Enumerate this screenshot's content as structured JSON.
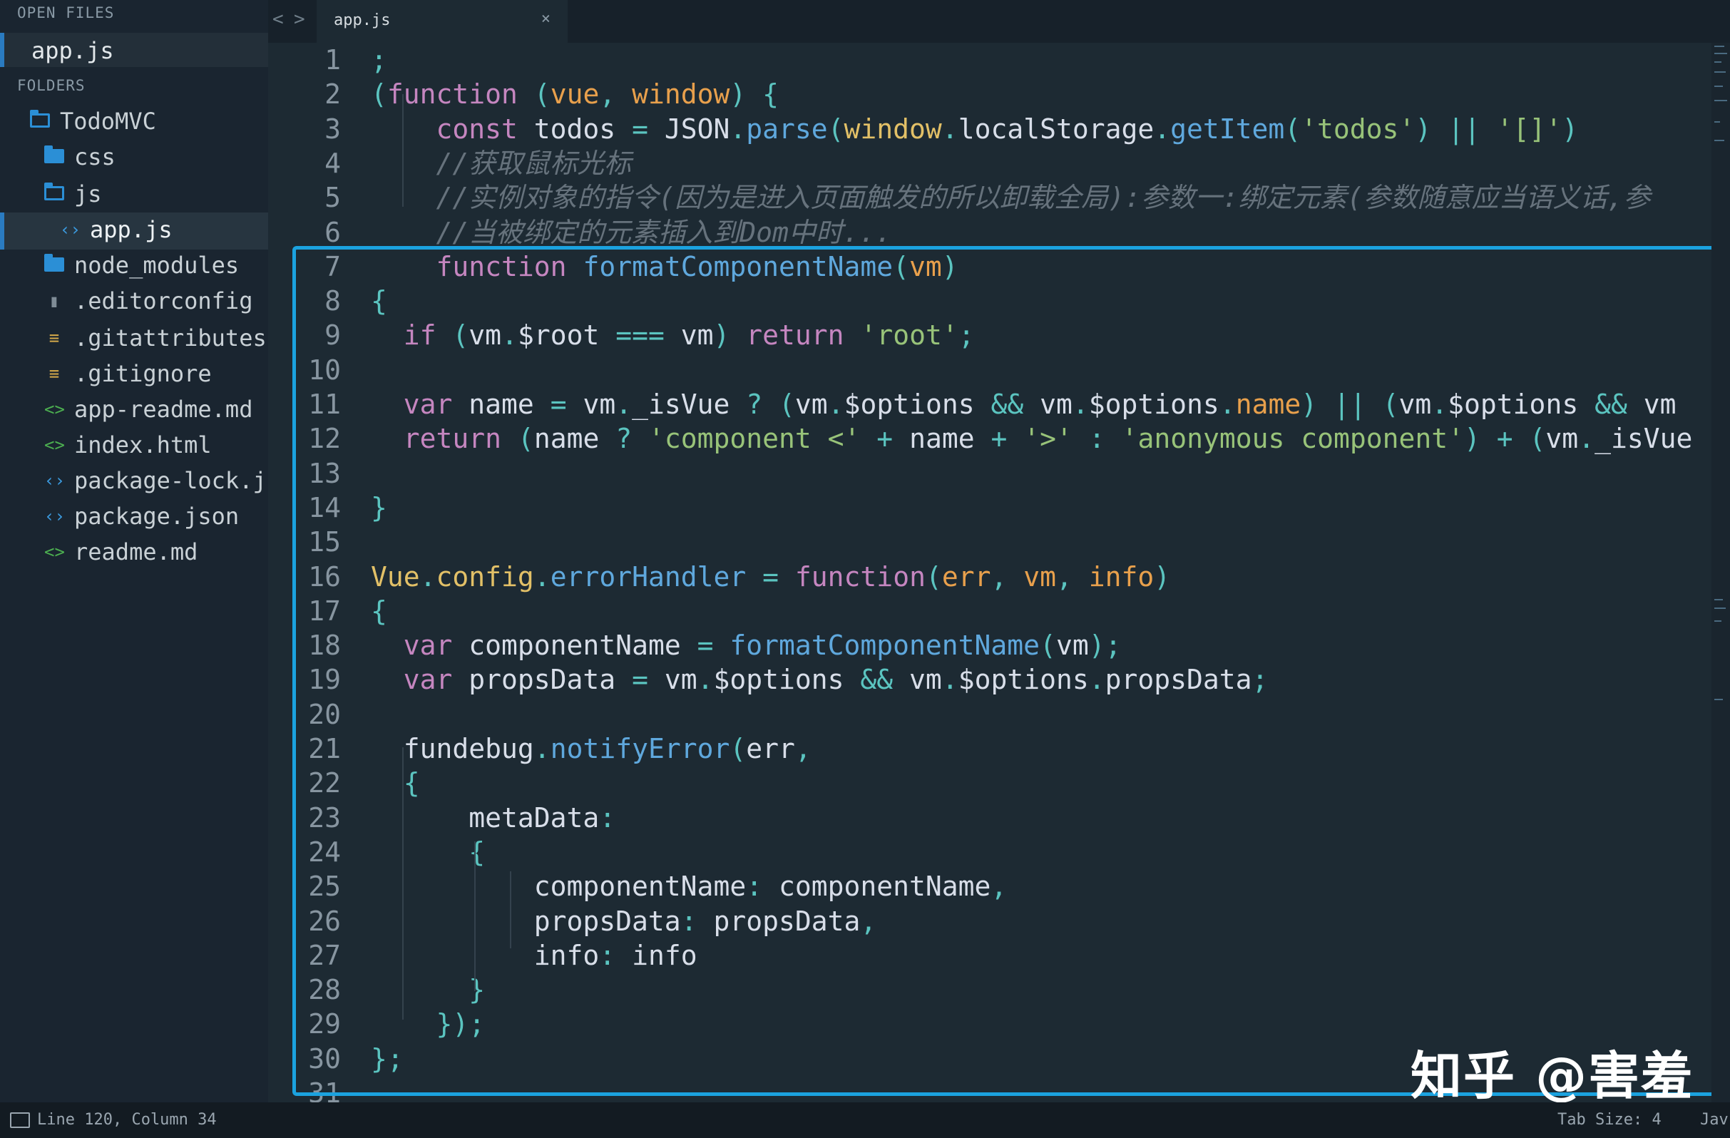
{
  "sidebar": {
    "open_files_header": "OPEN FILES",
    "open_file": "app.js",
    "folders_header": "FOLDERS",
    "tree": [
      {
        "label": "TodoMVC",
        "type": "folder-open"
      },
      {
        "label": "css",
        "type": "folder"
      },
      {
        "label": "js",
        "type": "folder-open"
      },
      {
        "label": "app.js",
        "type": "code-file"
      },
      {
        "label": "node_modules",
        "type": "folder"
      },
      {
        "label": ".editorconfig",
        "type": "file"
      },
      {
        "label": ".gitattributes",
        "type": "text-file"
      },
      {
        "label": ".gitignore",
        "type": "text-file"
      },
      {
        "label": "app-readme.md",
        "type": "markup-file"
      },
      {
        "label": "index.html",
        "type": "markup-file"
      },
      {
        "label": "package-lock.j",
        "type": "code-file"
      },
      {
        "label": "package.json",
        "type": "code-file"
      },
      {
        "label": "readme.md",
        "type": "markup-file"
      }
    ]
  },
  "tabs": {
    "nav_back": "<",
    "nav_forward": ">",
    "active_tab": "app.js",
    "close_glyph": "×"
  },
  "editor": {
    "line_numbers": [
      "1",
      "2",
      "3",
      "4",
      "5",
      "6",
      "7",
      "8",
      "9",
      "10",
      "11",
      "12",
      "13",
      "14",
      "15",
      "16",
      "17",
      "18",
      "19",
      "20",
      "21",
      "22",
      "23",
      "24",
      "25",
      "26",
      "27",
      "28",
      "29",
      "30",
      "31"
    ],
    "lines": [
      [
        [
          ";",
          "o"
        ]
      ],
      [
        [
          "(",
          "o"
        ],
        [
          "function",
          "k"
        ],
        [
          " (",
          "o"
        ],
        [
          "vue",
          "p"
        ],
        [
          ", ",
          "o"
        ],
        [
          "window",
          "p"
        ],
        [
          ") {",
          "o"
        ]
      ],
      [
        [
          "    ",
          ""
        ],
        [
          "const",
          "k"
        ],
        [
          " todos ",
          "t"
        ],
        [
          "=",
          "o"
        ],
        [
          " JSON",
          "t"
        ],
        [
          ".",
          "o"
        ],
        [
          "parse",
          "f"
        ],
        [
          "(",
          "o"
        ],
        [
          "window",
          "y"
        ],
        [
          ".",
          "o"
        ],
        [
          "localStorage",
          "t"
        ],
        [
          ".",
          "o"
        ],
        [
          "getItem",
          "f"
        ],
        [
          "(",
          "o"
        ],
        [
          "'todos'",
          "s"
        ],
        [
          ") ",
          "o"
        ],
        [
          "||",
          "o"
        ],
        [
          " ",
          "t"
        ],
        [
          "'[]'",
          "s"
        ],
        [
          ")",
          "o"
        ]
      ],
      [
        [
          "    //获取鼠标光标",
          "c"
        ]
      ],
      [
        [
          "    //实例对象的指令(因为是进入页面触发的所以卸载全局):参数一:绑定元素(参数随意应当语义话,参",
          "c"
        ]
      ],
      [
        [
          "    //当被绑定的元素插入到Dom中时...",
          "c"
        ]
      ],
      [
        [
          "    ",
          ""
        ],
        [
          "function",
          "k"
        ],
        [
          " ",
          "t"
        ],
        [
          "formatComponentName",
          "f"
        ],
        [
          "(",
          "o"
        ],
        [
          "vm",
          "p"
        ],
        [
          ")",
          "o"
        ]
      ],
      [
        [
          "{",
          "o"
        ]
      ],
      [
        [
          "  ",
          ""
        ],
        [
          "if",
          "k"
        ],
        [
          " (",
          "o"
        ],
        [
          "vm",
          "t"
        ],
        [
          ".",
          "o"
        ],
        [
          "$root",
          "t"
        ],
        [
          " ",
          "t"
        ],
        [
          "===",
          "o"
        ],
        [
          " vm",
          "t"
        ],
        [
          ") ",
          "o"
        ],
        [
          "return",
          "k"
        ],
        [
          " ",
          "t"
        ],
        [
          "'root'",
          "s"
        ],
        [
          ";",
          "o"
        ]
      ],
      [
        [
          "",
          ""
        ]
      ],
      [
        [
          "  ",
          ""
        ],
        [
          "var",
          "k"
        ],
        [
          " name ",
          "t"
        ],
        [
          "=",
          "o"
        ],
        [
          " vm",
          "t"
        ],
        [
          ".",
          "o"
        ],
        [
          "_isVue ",
          "t"
        ],
        [
          "?",
          "o"
        ],
        [
          " (",
          "o"
        ],
        [
          "vm",
          "t"
        ],
        [
          ".",
          "o"
        ],
        [
          "$options ",
          "t"
        ],
        [
          "&&",
          "o"
        ],
        [
          " vm",
          "t"
        ],
        [
          ".",
          "o"
        ],
        [
          "$options",
          "t"
        ],
        [
          ".",
          "o"
        ],
        [
          "name",
          "p"
        ],
        [
          ") ",
          "o"
        ],
        [
          "||",
          "o"
        ],
        [
          " (",
          "o"
        ],
        [
          "vm",
          "t"
        ],
        [
          ".",
          "o"
        ],
        [
          "$options ",
          "t"
        ],
        [
          "&&",
          "o"
        ],
        [
          " vm",
          "t"
        ]
      ],
      [
        [
          "  ",
          ""
        ],
        [
          "return",
          "k"
        ],
        [
          " (",
          "o"
        ],
        [
          "name ",
          "t"
        ],
        [
          "?",
          "o"
        ],
        [
          " ",
          "t"
        ],
        [
          "'component <'",
          "s"
        ],
        [
          " ",
          "t"
        ],
        [
          "+",
          "o"
        ],
        [
          " name ",
          "t"
        ],
        [
          "+",
          "o"
        ],
        [
          " ",
          "t"
        ],
        [
          "'>'",
          "s"
        ],
        [
          " ",
          "t"
        ],
        [
          ":",
          "o"
        ],
        [
          " ",
          "t"
        ],
        [
          "'anonymous component'",
          "s"
        ],
        [
          ") ",
          "o"
        ],
        [
          "+",
          "o"
        ],
        [
          " (",
          "o"
        ],
        [
          "vm",
          "t"
        ],
        [
          ".",
          "o"
        ],
        [
          "_isVue",
          "t"
        ]
      ],
      [
        [
          "",
          ""
        ]
      ],
      [
        [
          "}",
          "o"
        ]
      ],
      [
        [
          "",
          ""
        ]
      ],
      [
        [
          "Vue",
          "y"
        ],
        [
          ".",
          "o"
        ],
        [
          "config",
          "y"
        ],
        [
          ".",
          "o"
        ],
        [
          "errorHandler",
          "f"
        ],
        [
          " ",
          "t"
        ],
        [
          "=",
          "o"
        ],
        [
          " ",
          "t"
        ],
        [
          "function",
          "k"
        ],
        [
          "(",
          "o"
        ],
        [
          "err",
          "p"
        ],
        [
          ", ",
          "o"
        ],
        [
          "vm",
          "p"
        ],
        [
          ", ",
          "o"
        ],
        [
          "info",
          "p"
        ],
        [
          ")",
          "o"
        ]
      ],
      [
        [
          "{",
          "o"
        ]
      ],
      [
        [
          "  ",
          ""
        ],
        [
          "var",
          "k"
        ],
        [
          " componentName ",
          "t"
        ],
        [
          "=",
          "o"
        ],
        [
          " ",
          "t"
        ],
        [
          "formatComponentName",
          "f"
        ],
        [
          "(",
          "o"
        ],
        [
          "vm",
          "t"
        ],
        [
          ");",
          "o"
        ]
      ],
      [
        [
          "  ",
          ""
        ],
        [
          "var",
          "k"
        ],
        [
          " propsData ",
          "t"
        ],
        [
          "=",
          "o"
        ],
        [
          " vm",
          "t"
        ],
        [
          ".",
          "o"
        ],
        [
          "$options ",
          "t"
        ],
        [
          "&&",
          "o"
        ],
        [
          " vm",
          "t"
        ],
        [
          ".",
          "o"
        ],
        [
          "$options",
          "t"
        ],
        [
          ".",
          "o"
        ],
        [
          "propsData",
          "t"
        ],
        [
          ";",
          "o"
        ]
      ],
      [
        [
          "",
          ""
        ]
      ],
      [
        [
          "  ",
          ""
        ],
        [
          "fundebug",
          "t"
        ],
        [
          ".",
          "o"
        ],
        [
          "notifyError",
          "f"
        ],
        [
          "(",
          "o"
        ],
        [
          "err",
          "t"
        ],
        [
          ",",
          "o"
        ]
      ],
      [
        [
          "  ",
          ""
        ],
        [
          "{",
          "o"
        ]
      ],
      [
        [
          "      ",
          ""
        ],
        [
          "metaData",
          "t"
        ],
        [
          ":",
          "o"
        ]
      ],
      [
        [
          "      ",
          ""
        ],
        [
          "{",
          "o"
        ]
      ],
      [
        [
          "          ",
          ""
        ],
        [
          "componentName",
          "t"
        ],
        [
          ":",
          "o"
        ],
        [
          " componentName",
          "t"
        ],
        [
          ",",
          "o"
        ]
      ],
      [
        [
          "          ",
          ""
        ],
        [
          "propsData",
          "t"
        ],
        [
          ":",
          "o"
        ],
        [
          " propsData",
          "t"
        ],
        [
          ",",
          "o"
        ]
      ],
      [
        [
          "          ",
          ""
        ],
        [
          "info",
          "t"
        ],
        [
          ":",
          "o"
        ],
        [
          " info",
          "t"
        ]
      ],
      [
        [
          "      ",
          ""
        ],
        [
          "}",
          "o"
        ]
      ],
      [
        [
          "    ",
          ""
        ],
        [
          "});",
          "o"
        ]
      ],
      [
        [
          "};",
          "o"
        ]
      ],
      [
        [
          "",
          ""
        ]
      ]
    ]
  },
  "watermark": "知乎 @害羞",
  "status": {
    "position": "Line 120, Column 34",
    "tab_size": "Tab Size: 4",
    "syntax": "Jav"
  },
  "colors": {
    "background": "#1d2a33",
    "sidebar": "#1a2530",
    "highlight_border": "#1ba2df",
    "keyword": "#c586c0",
    "function": "#5fa8dd",
    "string": "#98c379",
    "param": "#e8a04c",
    "operator": "#5bc4c0",
    "comment": "#66727c"
  }
}
